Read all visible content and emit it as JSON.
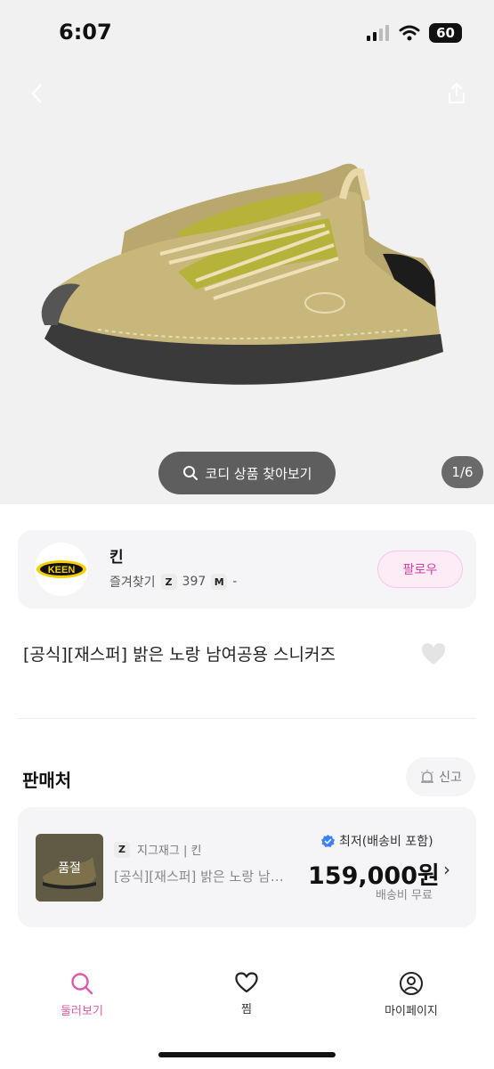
{
  "status_bar": {
    "time": "6:07",
    "battery": "60"
  },
  "hero": {
    "icons": {
      "back": "chevron-left-icon",
      "share": "share-icon"
    },
    "coordi_button": "코디 상품 찾아보기",
    "page_indicator": "1/6"
  },
  "store": {
    "logo_text": "KEEN",
    "name": "킨",
    "favorites_label": "즐겨찾기",
    "z_badge": "Z",
    "z_count": "397",
    "m_badge": "M",
    "m_value": "-",
    "follow_label": "팔로우"
  },
  "product": {
    "title": "[공식][재스퍼] 밝은 노랑 남여공용 스니커즈"
  },
  "sellers_section": {
    "title": "판매처",
    "report_label": "신고",
    "seller": {
      "soldout_label": "품절",
      "platform_badge": "Z",
      "platform_line": "지그재그 | 킨",
      "product_name": "[공식][재스퍼] 밝은 노랑 남…",
      "lowest_label": "최저(배송비 포함)",
      "price": "159,000원",
      "shipping": "배송비 무료"
    }
  },
  "tabbar": {
    "browse": "둘러보기",
    "wishlist": "찜",
    "mypage": "마이페이지"
  },
  "colors": {
    "accent": "#e05aa8",
    "verified": "#3b82f6",
    "shoe": "#c8b77a"
  }
}
